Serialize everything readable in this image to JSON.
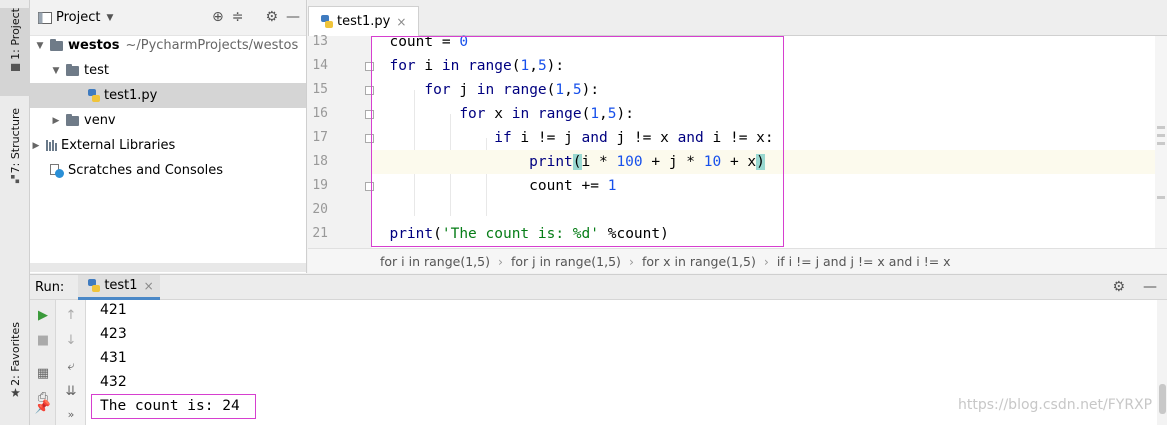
{
  "tool_strip": {
    "project_tab": "1: Project",
    "structure_tab": "7: Structure",
    "favorites_tab": "2: Favorites"
  },
  "project_panel": {
    "title": "Project",
    "tree": [
      {
        "label": "westos",
        "path": "~/PycharmProjects/westos"
      },
      {
        "label": "test"
      },
      {
        "label": "test1.py"
      },
      {
        "label": "venv"
      },
      {
        "label": "External Libraries"
      },
      {
        "label": "Scratches and Consoles"
      }
    ]
  },
  "editor": {
    "tab_label": "test1.py",
    "line_numbers": [
      "13",
      "14",
      "15",
      "16",
      "17",
      "18",
      "19",
      "20",
      "21"
    ],
    "breadcrumb": [
      "for i in range(1,5)",
      "for j in range(1,5)",
      "for x in range(1,5)",
      "if i != j and j != x and i != x"
    ]
  },
  "run_panel": {
    "label": "Run:",
    "tab_label": "test1",
    "output": [
      "421",
      "423",
      "431",
      "432",
      "The count is: 24"
    ]
  },
  "watermark": "https://blog.csdn.net/FYRXP",
  "colors": {
    "highlight_box": "#d63fcf",
    "keyword": "#000080",
    "number": "#1750eb",
    "string": "#067d17"
  }
}
